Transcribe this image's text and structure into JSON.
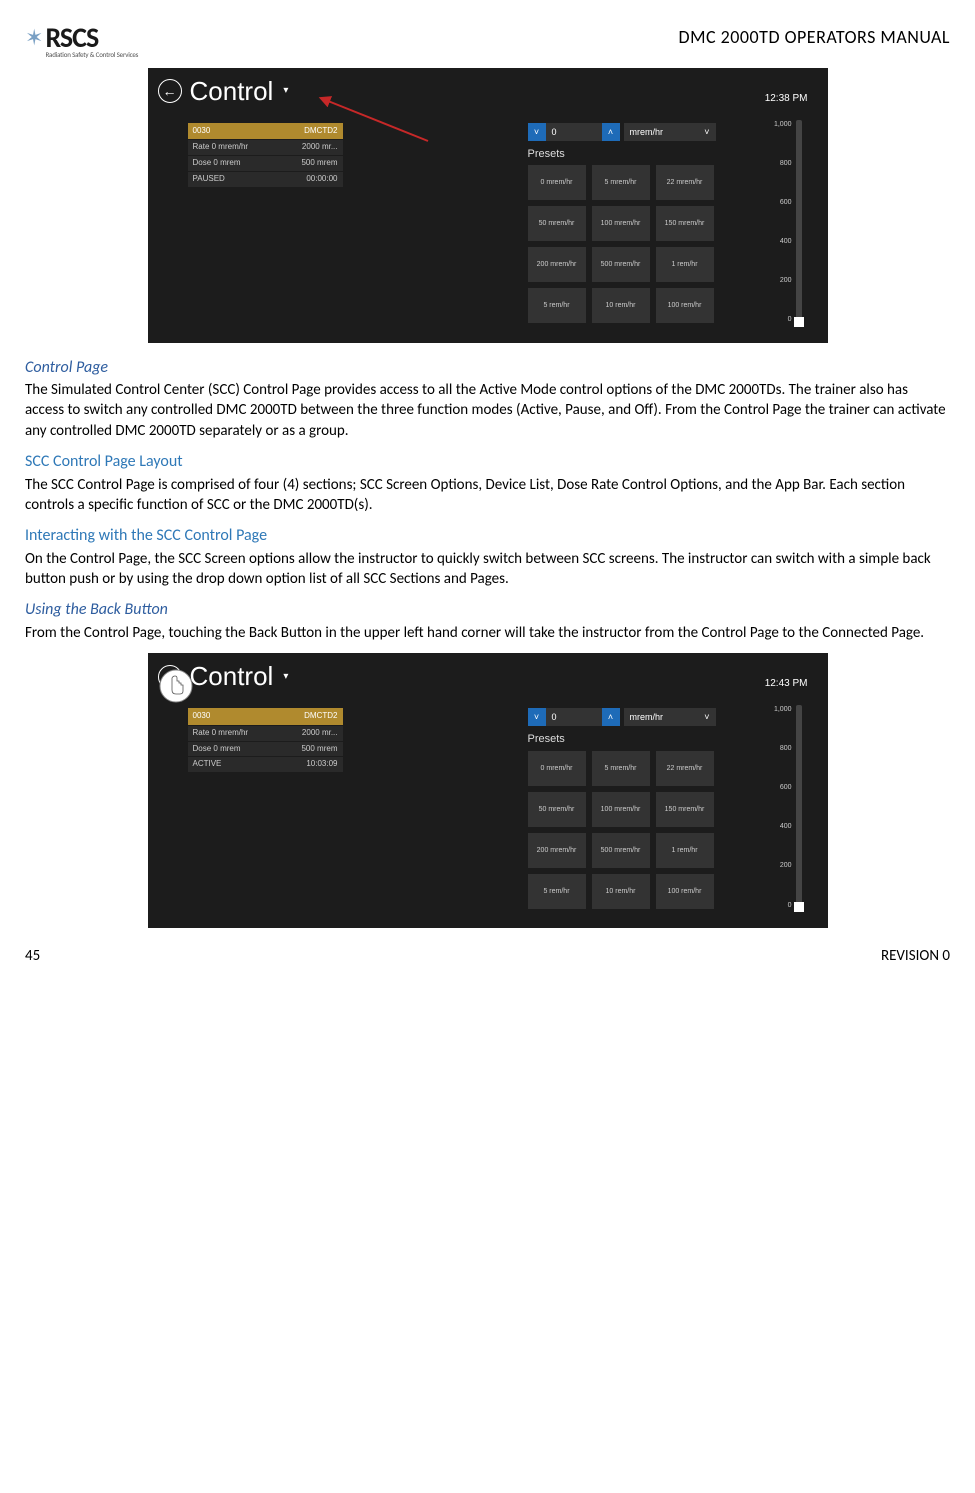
{
  "header": {
    "logo_text": "RSCS",
    "logo_sub": "Radiation Safety & Control Services",
    "doc_title": "DMC 2000TD OPERATORS MANUAL"
  },
  "screenshot1": {
    "title": "Control",
    "clock": "12:38 PM",
    "device": {
      "id": "0030",
      "name": "DMCTD2",
      "rows": [
        {
          "l": "Rate 0 mrem/hr",
          "r": "2000 mr..."
        },
        {
          "l": "Dose 0 mrem",
          "r": "500 mrem"
        },
        {
          "l": "PAUSED",
          "r": "00:00:00"
        }
      ]
    },
    "stepper_value": "0",
    "unit": "mrem/hr",
    "presets_label": "Presets",
    "presets": [
      "0 mrem/hr",
      "5 mrem/hr",
      "22 mrem/hr",
      "50 mrem/hr",
      "100 mrem/hr",
      "150 mrem/hr",
      "200 mrem/hr",
      "500 mrem/hr",
      "1 rem/hr",
      "5 rem/hr",
      "10 rem/hr",
      "100 rem/hr"
    ],
    "ticks": [
      "1,000",
      "800",
      "600",
      "400",
      "200",
      "0"
    ]
  },
  "screenshot2": {
    "title": "Control",
    "clock": "12:43 PM",
    "device": {
      "id": "0030",
      "name": "DMCTD2",
      "rows": [
        {
          "l": "Rate 0 mrem/hr",
          "r": "2000 mr..."
        },
        {
          "l": "Dose 0 mrem",
          "r": "500 mrem"
        },
        {
          "l": "ACTIVE",
          "r": "10:03:09"
        }
      ]
    },
    "stepper_value": "0",
    "unit": "mrem/hr",
    "presets_label": "Presets",
    "presets": [
      "0 mrem/hr",
      "5 mrem/hr",
      "22 mrem/hr",
      "50 mrem/hr",
      "100 mrem/hr",
      "150 mrem/hr",
      "200 mrem/hr",
      "500 mrem/hr",
      "1 rem/hr",
      "5 rem/hr",
      "10 rem/hr",
      "100 rem/hr"
    ],
    "ticks": [
      "1,000",
      "800",
      "600",
      "400",
      "200",
      "0"
    ]
  },
  "sections": {
    "s1_heading": "Control Page",
    "s1_body": "The Simulated Control Center (SCC) Control Page provides access to all the Active Mode control options of the DMC 2000TDs. The trainer also has access to switch any controlled DMC 2000TD between the three function modes (Active, Pause, and Off). From the Control Page the trainer can activate any controlled DMC 2000TD separately or as a group.",
    "s2_heading": "SCC Control Page Layout",
    "s2_body": "The SCC Control Page is comprised of four (4) sections; SCC Screen Options, Device List, Dose Rate Control Options, and the App Bar. Each section controls a specific function of SCC or the DMC 2000TD(s).",
    "s3_heading": "Interacting with the SCC Control Page",
    "s3_body": "On the Control Page, the SCC Screen options allow the instructor to quickly switch between SCC screens. The instructor can switch with a simple back button push or by using the drop down option list of all SCC Sections and Pages.",
    "s4_heading": "Using the Back Button",
    "s4_body": "From the Control Page, touching the Back Button in the upper left hand corner will take the instructor from the Control Page to the Connected Page."
  },
  "footer": {
    "page": "45",
    "rev": "REVISION 0"
  }
}
